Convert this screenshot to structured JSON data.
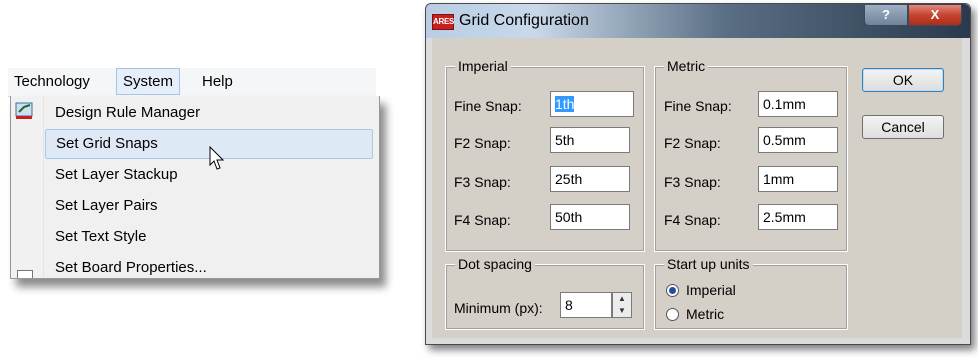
{
  "menu": {
    "bar": [
      "Technology",
      "System",
      "Help"
    ],
    "active": "Technology",
    "items": [
      "Design Rule Manager",
      "Set Grid Snaps",
      "Set Layer Stackup",
      "Set Layer Pairs",
      "Set Text Style",
      "Set Board Properties..."
    ],
    "highlighted": "Set Grid Snaps"
  },
  "dialog": {
    "app_badge": "ARES",
    "title": "Grid Configuration",
    "help_btn": "?",
    "close_btn": "X",
    "imperial": {
      "legend": "Imperial",
      "rows": [
        {
          "label": "Fine Snap:",
          "value": "1th"
        },
        {
          "label": "F2 Snap:",
          "value": "5th"
        },
        {
          "label": "F3 Snap:",
          "value": "25th"
        },
        {
          "label": "F4 Snap:",
          "value": "50th"
        }
      ]
    },
    "metric": {
      "legend": "Metric",
      "rows": [
        {
          "label": "Fine Snap:",
          "value": "0.1mm"
        },
        {
          "label": "F2 Snap:",
          "value": "0.5mm"
        },
        {
          "label": "F3 Snap:",
          "value": "1mm"
        },
        {
          "label": "F4 Snap:",
          "value": "2.5mm"
        }
      ]
    },
    "ok_label": "OK",
    "cancel_label": "Cancel",
    "dot_spacing": {
      "legend": "Dot spacing",
      "label": "Minimum (px):",
      "value": "8"
    },
    "startup": {
      "legend": "Start up units",
      "options": [
        "Imperial",
        "Metric"
      ],
      "selected": "Imperial"
    }
  }
}
